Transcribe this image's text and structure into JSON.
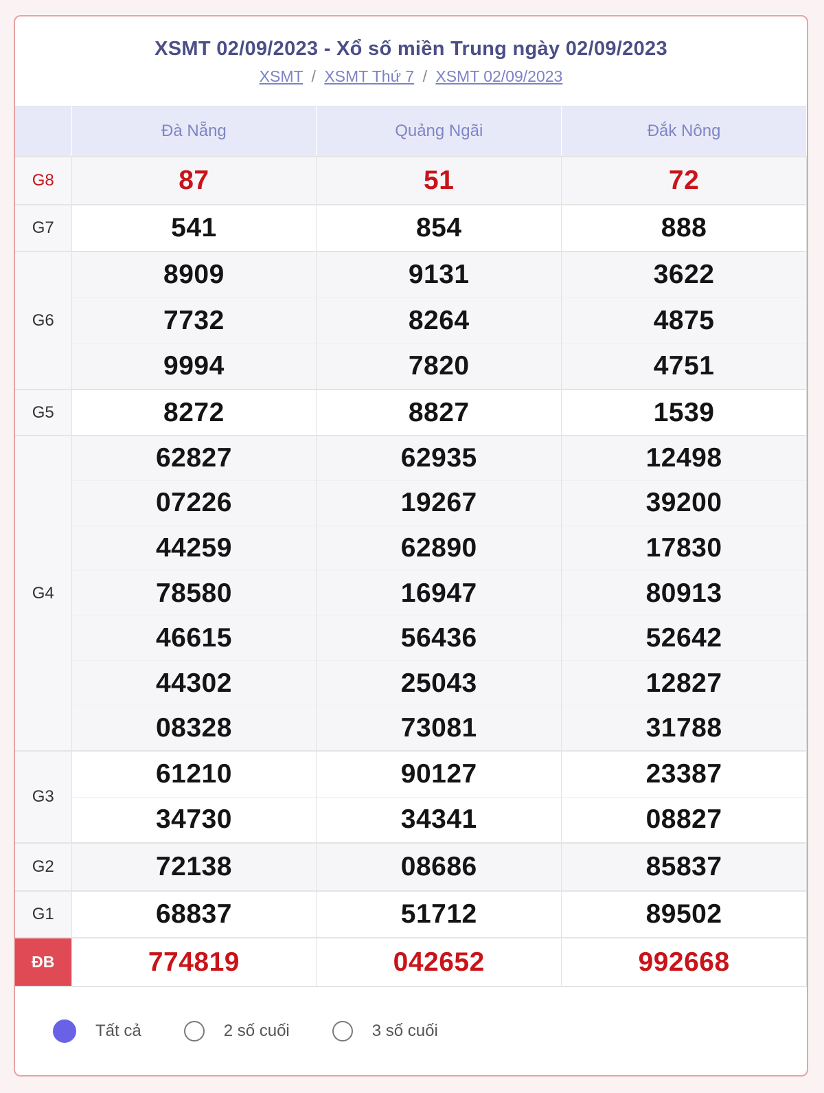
{
  "header": {
    "title": "XSMT 02/09/2023 - Xổ số miền Trung ngày 02/09/2023",
    "breadcrumbs": [
      "XSMT",
      "XSMT Thứ 7",
      "XSMT 02/09/2023"
    ],
    "separator": "/"
  },
  "table": {
    "provinces": [
      "Đà Nẵng",
      "Quảng Ngãi",
      "Đắk Nông"
    ],
    "prizes": {
      "g8": {
        "label": "G8",
        "rows": [
          [
            "87",
            "51",
            "72"
          ]
        ]
      },
      "g7": {
        "label": "G7",
        "rows": [
          [
            "541",
            "854",
            "888"
          ]
        ]
      },
      "g6": {
        "label": "G6",
        "rows": [
          [
            "8909",
            "9131",
            "3622"
          ],
          [
            "7732",
            "8264",
            "4875"
          ],
          [
            "9994",
            "7820",
            "4751"
          ]
        ]
      },
      "g5": {
        "label": "G5",
        "rows": [
          [
            "8272",
            "8827",
            "1539"
          ]
        ]
      },
      "g4": {
        "label": "G4",
        "rows": [
          [
            "62827",
            "62935",
            "12498"
          ],
          [
            "07226",
            "19267",
            "39200"
          ],
          [
            "44259",
            "62890",
            "17830"
          ],
          [
            "78580",
            "16947",
            "80913"
          ],
          [
            "46615",
            "56436",
            "52642"
          ],
          [
            "44302",
            "25043",
            "12827"
          ],
          [
            "08328",
            "73081",
            "31788"
          ]
        ]
      },
      "g3": {
        "label": "G3",
        "rows": [
          [
            "61210",
            "90127",
            "23387"
          ],
          [
            "34730",
            "34341",
            "08827"
          ]
        ]
      },
      "g2": {
        "label": "G2",
        "rows": [
          [
            "72138",
            "08686",
            "85837"
          ]
        ]
      },
      "g1": {
        "label": "G1",
        "rows": [
          [
            "68837",
            "51712",
            "89502"
          ]
        ]
      },
      "db": {
        "label": "ĐB",
        "rows": [
          [
            "774819",
            "042652",
            "992668"
          ]
        ]
      }
    }
  },
  "filter": {
    "options": [
      "Tất cả",
      "2 số cuối",
      "3 số cuối"
    ],
    "selected": "Tất cả"
  },
  "colors": {
    "accent": "#6a62e6",
    "header_text": "#4b4f86",
    "special_red": "#c8141a",
    "db_label_bg": "#e04a55"
  }
}
